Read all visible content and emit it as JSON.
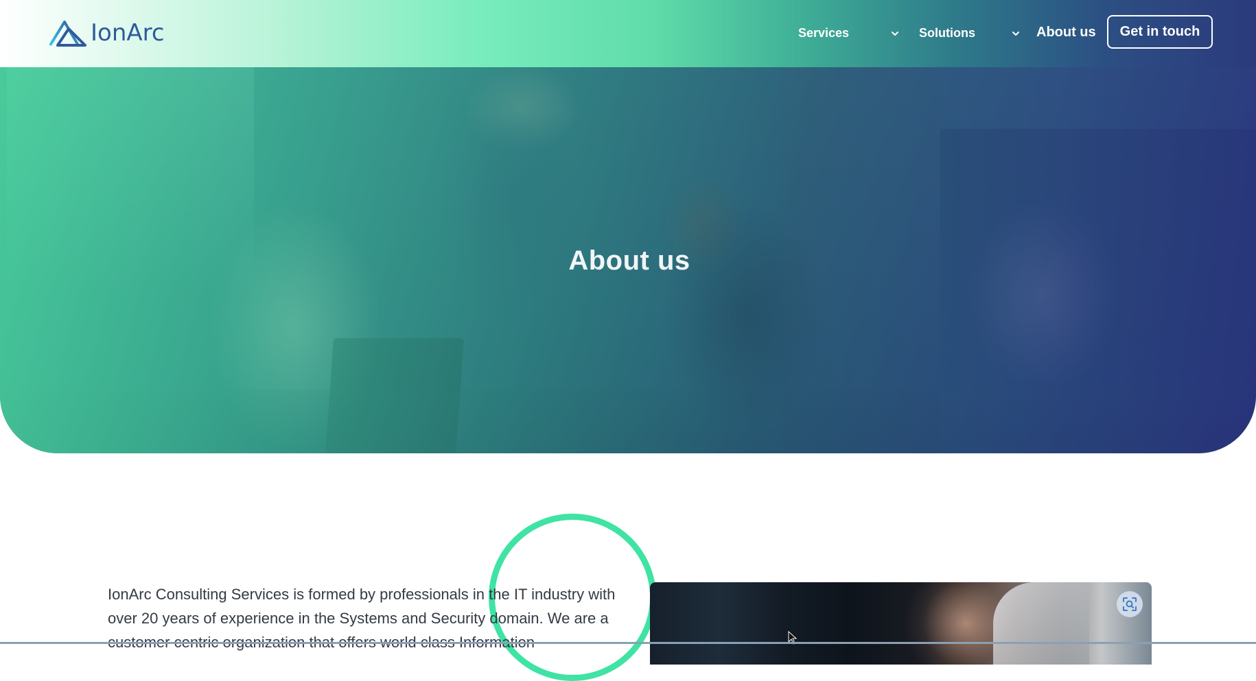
{
  "brand": {
    "name": "IonArc",
    "logo_icon": "ionarc-triangle-logo"
  },
  "nav": {
    "services_label": "Services",
    "solutions_label": "Solutions",
    "about_label": "About us",
    "cta_label": "Get in touch",
    "dropdown_icon": "chevron-down-icon"
  },
  "hero": {
    "title": "About us"
  },
  "intro": {
    "text": "IonArc Consulting Services is formed by professionals in the IT industry with over 20 years of experience in the Systems and Security domain. We are a customer centric organization that offers world class Information"
  },
  "media": {
    "action_icon": "visual-search-icon"
  },
  "colors": {
    "accent_green": "#3fe3a4",
    "brand_blue": "#2f5a9b",
    "deep_indigo": "#2b3a7c"
  }
}
